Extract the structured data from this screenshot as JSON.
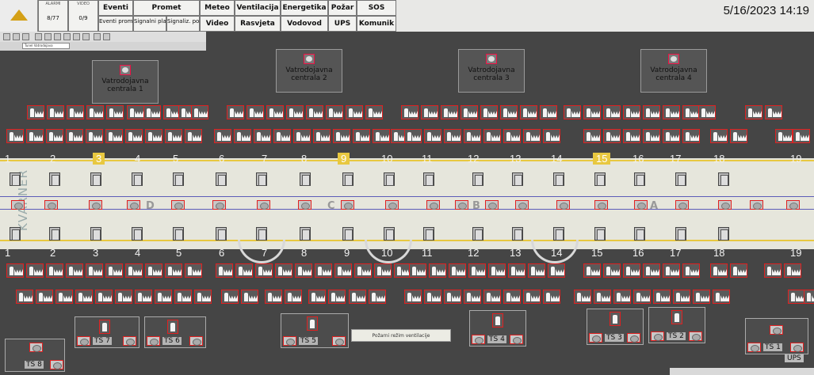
{
  "header": {
    "alarm": {
      "label": "ALARMI",
      "value": "8/77"
    },
    "video": {
      "label": "VIDEO",
      "value": "0/9"
    },
    "menu_row1": [
      "Eventi",
      "Promet",
      "Meteo",
      "Ventilacija",
      "Energetika",
      "Požar",
      "SOS"
    ],
    "menu_row2": [
      "Video",
      "Rasvjeta",
      "Vodovod",
      "UPS",
      "Komunik"
    ],
    "sub_items": [
      "Eventi promet",
      "Signalni planovi",
      "Signaliz. portali"
    ],
    "datetime": "5/16/2023 14:19"
  },
  "toolbar": {
    "field_text": "Tunel Vatrodojava"
  },
  "centrals": [
    "Vatrodojavna centrala 1",
    "Vatrodojavna centrala 2",
    "Vatrodojavna centrala 3",
    "Vatrodojavna centrala 4"
  ],
  "sections": [
    "1",
    "2",
    "3",
    "4",
    "5",
    "6",
    "7",
    "8",
    "9",
    "10",
    "11",
    "12",
    "13",
    "14",
    "15",
    "16",
    "17",
    "18",
    "19"
  ],
  "segments": [
    "D",
    "C",
    "B",
    "A"
  ],
  "stations": [
    "TS 8",
    "TS 7",
    "TS 6",
    "TS 5",
    "TS 4",
    "TS 3",
    "TS 2",
    "TS 1"
  ],
  "ventilation_button": "Požarni režim ventilacije",
  "ups_label": "UPS",
  "colors": {
    "alarm_border": "#e02020",
    "highlight": "#e8c840",
    "background": "#454545"
  }
}
